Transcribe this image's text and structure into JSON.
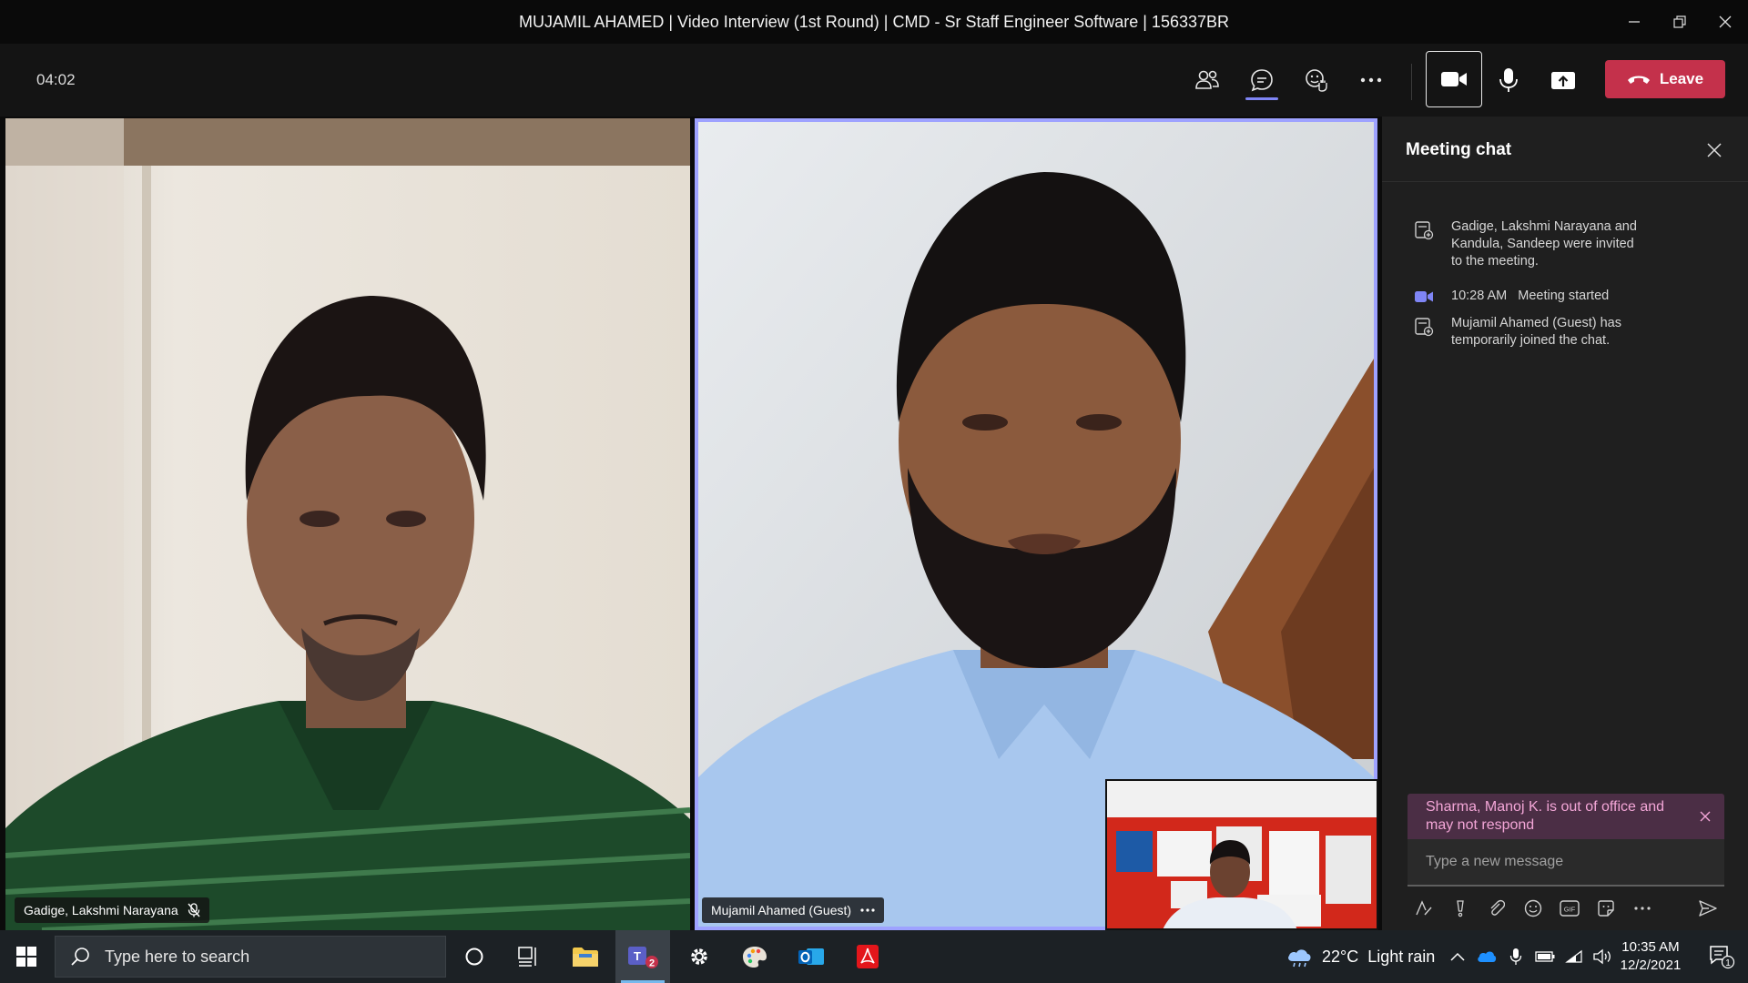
{
  "window": {
    "title": "MUJAMIL AHAMED | Video Interview (1st Round) | CMD - Sr Staff Engineer Software | 156337BR"
  },
  "call": {
    "timer": "04:02",
    "leave_label": "Leave"
  },
  "participants": [
    {
      "name": "Gadige, Lakshmi Narayana",
      "muted": true
    },
    {
      "name": "Mujamil Ahamed (Guest)",
      "active_speaker": true
    }
  ],
  "chat": {
    "title": "Meeting chat",
    "events": [
      {
        "icon": "people-add-icon",
        "time": "",
        "lines": [
          "Gadige, Lakshmi Narayana and",
          "Kandula, Sandeep were invited",
          "to the meeting."
        ]
      },
      {
        "icon": "video-camera-icon",
        "time": "10:28 AM",
        "lines": [
          "Meeting started"
        ]
      },
      {
        "icon": "people-add-icon",
        "time": "",
        "lines": [
          "Mujamil Ahamed (Guest) has",
          "temporarily joined the chat."
        ]
      }
    ],
    "oof_notice_lines": [
      "Sharma, Manoj K. is out of office and",
      "may not respond"
    ],
    "composer_placeholder": "Type a new message"
  },
  "taskbar": {
    "search_placeholder": "Type here to search",
    "teams_badge": "2",
    "weather_temp": "22°C",
    "weather_desc": "Light rain",
    "time": "10:35 AM",
    "date": "12/2/2021",
    "notifications_count": "1"
  },
  "colors": {
    "accent": "#7f85f5",
    "leave": "#c4314b",
    "oof_bg": "#4b2e45",
    "oof_text": "#f3a6d7",
    "panel": "#1f1f1f"
  }
}
